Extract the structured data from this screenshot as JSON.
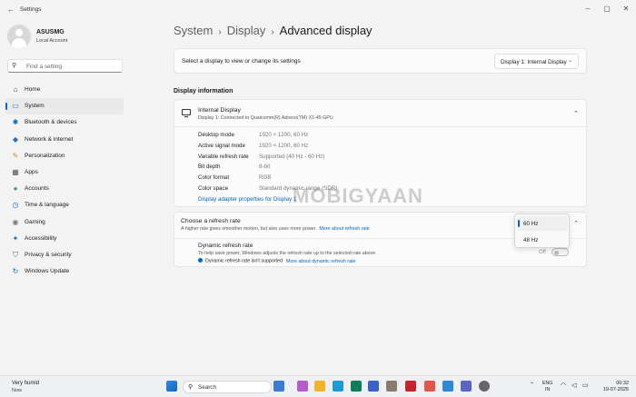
{
  "window": {
    "title": "Settings"
  },
  "profile": {
    "name": "ASUSMG",
    "account": "Local Account"
  },
  "search": {
    "placeholder": "Find a setting"
  },
  "sidebar": {
    "items": [
      {
        "label": "Home",
        "icon": "home-icon",
        "glyph": "⌂",
        "color": "#444444"
      },
      {
        "label": "System",
        "icon": "system-icon",
        "glyph": "▭",
        "color": "#0067c0"
      },
      {
        "label": "Bluetooth & devices",
        "icon": "bluetooth-icon",
        "glyph": "✱",
        "color": "#0067c0"
      },
      {
        "label": "Network & internet",
        "icon": "network-icon",
        "glyph": "◆",
        "color": "#1a6fd1"
      },
      {
        "label": "Personalization",
        "icon": "personalization-icon",
        "glyph": "✎",
        "color": "#c9892a"
      },
      {
        "label": "Apps",
        "icon": "apps-icon",
        "glyph": "▦",
        "color": "#555555"
      },
      {
        "label": "Accounts",
        "icon": "accounts-icon",
        "glyph": "●",
        "color": "#2f9e5b"
      },
      {
        "label": "Time & language",
        "icon": "time-language-icon",
        "glyph": "◷",
        "color": "#1a6fd1"
      },
      {
        "label": "Gaming",
        "icon": "gaming-icon",
        "glyph": "◉",
        "color": "#777777"
      },
      {
        "label": "Accessibility",
        "icon": "accessibility-icon",
        "glyph": "✦",
        "color": "#0f6cbd"
      },
      {
        "label": "Privacy & security",
        "icon": "privacy-shield-icon",
        "glyph": "⛉",
        "color": "#666666"
      },
      {
        "label": "Windows Update",
        "icon": "windows-update-icon",
        "glyph": "↻",
        "color": "#0067c0"
      }
    ]
  },
  "breadcrumb": {
    "part1": "System",
    "part2": "Display",
    "current": "Advanced display"
  },
  "selector": {
    "text": "Select a display to view or change its settings",
    "value": "Display 1: Internal Display"
  },
  "display_info": {
    "section_title": "Display information",
    "name": "Internal Display",
    "subtitle": "Display 1: Connected to Qualcomm(R) Adreno(TM) X1-45 GPU",
    "rows": [
      {
        "key": "Desktop mode",
        "value": "1920 × 1200, 60 Hz"
      },
      {
        "key": "Active signal mode",
        "value": "1920 × 1200, 60 Hz"
      },
      {
        "key": "Variable refresh rate",
        "value": "Supported (40 Hz - 60 Hz)"
      },
      {
        "key": "Bit depth",
        "value": "8-bit"
      },
      {
        "key": "Color format",
        "value": "RGB"
      },
      {
        "key": "Color space",
        "value": "Standard dynamic range (SDR)"
      }
    ],
    "adapter_link": "Display adapter properties for Display 1"
  },
  "refresh": {
    "title": "Choose a refresh rate",
    "subtitle": "A higher rate gives smoother motion, but also uses more power",
    "more_link": "More about refresh rate",
    "options": [
      "60 Hz",
      "48 Hz"
    ],
    "selected": "60 Hz",
    "dynamic_title": "Dynamic refresh rate",
    "dynamic_sub": "To help save power, Windows adjusts the refresh rate up to the selected rate above",
    "dynamic_warning": "Dynamic refresh rate isn't supported",
    "dynamic_link": "More about dynamic refresh rate",
    "toggle_label": "Off"
  },
  "watermark": "MOBIGYAAN",
  "taskbar": {
    "weather_title": "Very humid",
    "weather_sub": "Now",
    "search_label": "Search",
    "apps": [
      {
        "icon": "start-icon",
        "color": "#1f7ad6"
      },
      {
        "icon": "app-icon-1",
        "color": "#6d6d6d"
      },
      {
        "icon": "app-icon-2",
        "color": "#3a7bd5"
      },
      {
        "icon": "copilot-icon",
        "color": "#b45cc9"
      },
      {
        "icon": "file-explorer-icon",
        "color": "#f0b429"
      },
      {
        "icon": "edge-icon",
        "color": "#1c9bd6"
      },
      {
        "icon": "app-icon-3",
        "color": "#0a7d5a"
      },
      {
        "icon": "app-icon-4",
        "color": "#3a62c9"
      },
      {
        "icon": "app-icon-5",
        "color": "#8a7b6a"
      },
      {
        "icon": "mcafee-icon",
        "color": "#c8232c"
      },
      {
        "icon": "app-icon-6",
        "color": "#e0584a"
      },
      {
        "icon": "app-icon-7",
        "color": "#2a8ad8"
      },
      {
        "icon": "app-icon-8",
        "color": "#5865c5"
      },
      {
        "icon": "settings-icon",
        "color": "#666666"
      }
    ],
    "lang_1": "ENG",
    "lang_2": "IN",
    "time": "00:32",
    "date": "19-07-2025"
  }
}
